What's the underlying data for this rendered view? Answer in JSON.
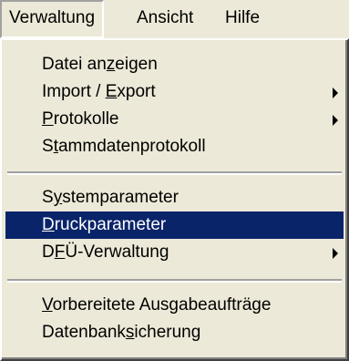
{
  "menubar": {
    "items": [
      {
        "label": "Verwaltung",
        "open": true
      },
      {
        "label": "Ansicht"
      },
      {
        "label": "Hilfe"
      }
    ]
  },
  "menu": {
    "group1": [
      {
        "pre": "Datei an",
        "acc": "z",
        "post": "eigen",
        "submenu": false
      },
      {
        "pre": "Import / ",
        "acc": "E",
        "post": "xport",
        "submenu": true
      },
      {
        "pre": "",
        "acc": "P",
        "post": "rotokolle",
        "submenu": true
      },
      {
        "pre": "S",
        "acc": "t",
        "post": "ammdatenprotokoll",
        "submenu": false
      }
    ],
    "group2": [
      {
        "pre": "S",
        "acc": "y",
        "post": "stemparameter",
        "submenu": false
      },
      {
        "pre": "",
        "acc": "D",
        "post": "ruckparameter",
        "submenu": false,
        "selected": true
      },
      {
        "pre": "D",
        "acc": "F",
        "post": "Ü-Verwaltung",
        "submenu": true
      }
    ],
    "group3": [
      {
        "pre": "",
        "acc": "V",
        "post": "orbereitete Ausgabeaufträge",
        "submenu": false
      },
      {
        "pre": "Datenbank",
        "acc": "s",
        "post": "icherung",
        "submenu": false
      }
    ]
  },
  "colors": {
    "menu_bg": "#ece9d8",
    "highlight_bg": "#0a246a",
    "highlight_fg": "#ffffff"
  }
}
